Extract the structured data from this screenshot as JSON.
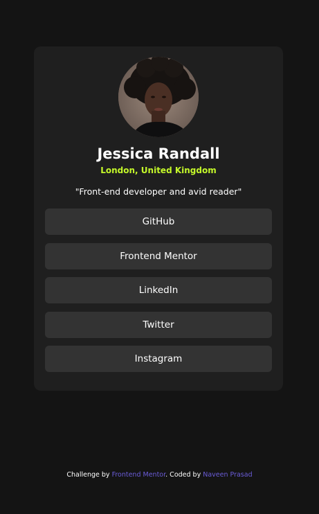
{
  "profile": {
    "name": "Jessica Randall",
    "location": "London, United Kingdom",
    "bio": "\"Front-end developer and avid reader\""
  },
  "links": [
    {
      "label": "GitHub"
    },
    {
      "label": "Frontend Mentor"
    },
    {
      "label": "LinkedIn"
    },
    {
      "label": "Twitter"
    },
    {
      "label": "Instagram"
    }
  ],
  "footer": {
    "prefix": "Challenge by ",
    "challenge_link": "Frontend Mentor",
    "middle": ". Coded by ",
    "author_link": "Naveen Prasad"
  },
  "colors": {
    "background": "#141414",
    "card": "#1f1f1f",
    "button": "#333333",
    "accent": "#c4f82a",
    "footer_link": "#6a5cd8"
  }
}
